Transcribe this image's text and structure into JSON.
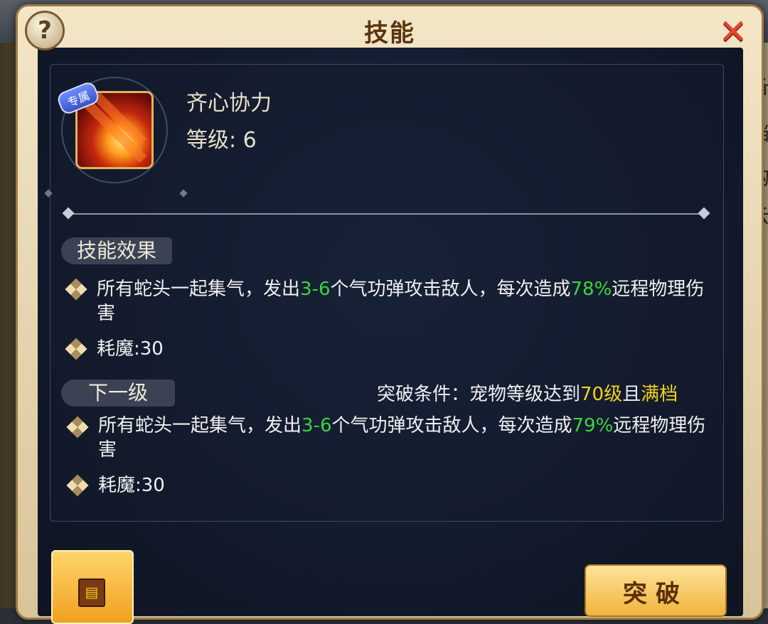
{
  "dialog": {
    "title": "技能",
    "help_label": "?",
    "close_label": "✕"
  },
  "skill": {
    "badge": "专属",
    "name": "齐心协力",
    "level_label": "等级: 6"
  },
  "current": {
    "tag": "技能效果",
    "desc_parts": [
      "所有蛇头一起集气，发出",
      "3-6",
      "个气功弹攻击敌人，每次造成",
      "78%",
      "远程物理伤害"
    ],
    "cost": "耗魔:30"
  },
  "next": {
    "tag": "下一级",
    "condition_prefix": "突破条件：宠物等级达到",
    "condition_level": "70级",
    "condition_mid": "且",
    "condition_full": "满档",
    "desc_parts": [
      "所有蛇头一起集气，发出",
      "3-6",
      "个气功弹攻击敌人，每次造成",
      "79%",
      "远程物理伤害"
    ],
    "cost": "耗魔:30"
  },
  "buttons": {
    "breakthrough": "突破",
    "book_icon": "book-icon"
  },
  "background": {
    "right_chars": [
      "备",
      "档",
      "购",
      "云"
    ]
  },
  "colors": {
    "highlight_green": "#3ed23e",
    "highlight_yellow": "#f2d21a",
    "title_brown": "#5a3410",
    "close_red": "#e0452e"
  }
}
